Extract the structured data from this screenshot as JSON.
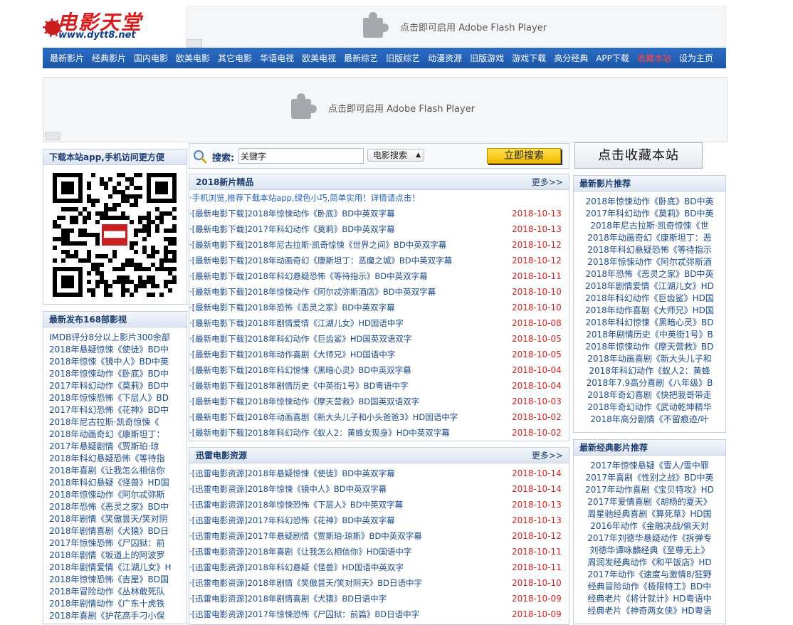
{
  "logo": {
    "title": "电影天堂",
    "domain": "www.dytt8.net"
  },
  "flash": {
    "message": "点击即可启用 Adobe Flash Player"
  },
  "nav": {
    "items": [
      "最新影片",
      "经典影片",
      "国内电影",
      "欧美电影",
      "其它电影",
      "华语电视",
      "欧美电视",
      "最新综艺",
      "旧版综艺",
      "动漫资源",
      "旧版游戏",
      "游戏下载",
      "高分经典",
      "APP下载",
      "收藏本站",
      "设为主页"
    ],
    "highlight_index": 14
  },
  "left_app": {
    "title": "下载本站app,手机访问更方便"
  },
  "left_new": {
    "title": "最新发布168部影视",
    "items": [
      "IMDB评分8分以上影片300余部",
      "2018年悬疑惊悚《使徒》BD中",
      "2018年惊悚《镜中人》BD中英",
      "2018年惊悚动作《卧底》BD中",
      "2017年科幻动作《莫莉》BD中",
      "2018年惊悚恐怖《下层人》BD",
      "2017年科幻恐怖《花神》BD中",
      "2018年尼古拉斯·凯奇惊悚《",
      "2018年动画奇幻《康斯坦丁：",
      "2017年悬疑剧情《贾斯珀·琼",
      "2018年科幻悬疑恐怖《等待指",
      "2018年喜剧《让我怎么相信你",
      "2018年科幻悬疑《怪兽》HD国",
      "2018年惊悚动作《阿尔忒弥斯",
      "2018年恐怖《恶灵之家》BD中",
      "2018年剧情《笑傲昙天/笑对阴",
      "2018年剧情喜剧《犬猿》BD日",
      "2017年惊悚恐怖《尸囚狱：前",
      "2018年剧情《坂道上的阿波罗",
      "2018年剧情爱情《江湖儿女》H",
      "2018年惊悚恐怖《吉屋》BD国",
      "2018年冒险动作《丛林敢死队",
      "2018年剧情动作《广东十虎铁",
      "2018年喜剧《护花高手刁小保"
    ]
  },
  "search": {
    "label": "搜索:",
    "value": "关键字",
    "select_value": "电影搜索",
    "button": "立即搜索"
  },
  "panel_new": {
    "title": "2018新片精品",
    "more": "更多>>",
    "notice": "·手机浏览,推荐下载本站app,绿色小巧,简单实用！详情请点击！",
    "rows": [
      {
        "title": "·[最新电影下载]2018年惊悚动作《卧底》BD中英双字幕",
        "date": "2018-10-13"
      },
      {
        "title": "·[最新电影下载]2017年科幻动作《莫莉》BD中英双字幕",
        "date": "2018-10-13"
      },
      {
        "title": "·[最新电影下载]2018年尼古拉斯·凯奇惊悚《世界之间》BD中英双字幕",
        "date": "2018-10-12"
      },
      {
        "title": "·[最新电影下载]2018年动画奇幻《康斯坦丁：恶魔之城》BD中英双字幕",
        "date": "2018-10-12"
      },
      {
        "title": "·[最新电影下载]2018年科幻悬疑恐怖《等待指示》BD中英双字幕",
        "date": "2018-10-11"
      },
      {
        "title": "·[最新电影下载]2018年惊悚动作《阿尔忒弥斯酒店》BD中英双字幕",
        "date": "2018-10-10"
      },
      {
        "title": "·[最新电影下载]2018年恐怖《恶灵之家》BD中英双字幕",
        "date": "2018-10-10"
      },
      {
        "title": "·[最新电影下载]2018年剧情爱情《江湖儿女》HD国语中字",
        "date": "2018-10-08"
      },
      {
        "title": "·[最新电影下载]2018年科幻动作《巨齿鲨》HD国英双语双字",
        "date": "2018-10-05"
      },
      {
        "title": "·[最新电影下载]2018年动作喜剧《大师兄》HD国语中字",
        "date": "2018-10-05"
      },
      {
        "title": "·[最新电影下载]2018年科幻惊悚《黑暗心灵》BD中英双字幕",
        "date": "2018-10-04"
      },
      {
        "title": "·[最新电影下载]2018年剧情历史《中英街1号》BD粤语中字",
        "date": "2018-10-04"
      },
      {
        "title": "·[最新电影下载]2018年惊悚动作《摩天营救》BD国英双语双字",
        "date": "2018-10-03"
      },
      {
        "title": "·[最新电影下载]2018年动画喜剧《新大头儿子和小头爸爸3》HD国语中字",
        "date": "2018-10-02"
      },
      {
        "title": "·[最新电影下载]2018年科幻动作《蚁人2：黄蜂女现身》HD中英双字幕",
        "date": "2018-10-02"
      }
    ]
  },
  "panel_xunlei": {
    "title": "迅雷电影资源",
    "more": "更多>>",
    "rows": [
      {
        "title": "·[迅雷电影资源]2018年悬疑惊悚《使徒》BD中英双字幕",
        "date": "2018-10-14"
      },
      {
        "title": "·[迅雷电影资源]2018年惊悚《镜中人》BD中英双字幕",
        "date": "2018-10-14"
      },
      {
        "title": "·[迅雷电影资源]2018年惊悚恐怖《下层人》BD中英双字幕",
        "date": "2018-10-13"
      },
      {
        "title": "·[迅雷电影资源]2017年科幻恐怖《花神》BD中英双字幕",
        "date": "2018-10-13"
      },
      {
        "title": "·[迅雷电影资源]2017年悬疑剧情《贾斯珀·琼斯》BD中英双字幕",
        "date": "2018-10-12"
      },
      {
        "title": "·[迅雷电影资源]2018年喜剧《让我怎么相信你》HD国语中字",
        "date": "2018-10-11"
      },
      {
        "title": "·[迅雷电影资源]2018年科幻悬疑《怪兽》HD国语中英双字",
        "date": "2018-10-11"
      },
      {
        "title": "·[迅雷电影资源]2018年剧情《笑傲昙天/笑对阴天》BD日语中字",
        "date": "2018-10-10"
      },
      {
        "title": "·[迅雷电影资源]2018年剧情喜剧《犬猿》BD日语中字",
        "date": "2018-10-09"
      },
      {
        "title": "·[迅雷电影资源]2017年惊悚恐怖《尸囚狱：前篇》BD日语中字",
        "date": "2018-10-09"
      }
    ]
  },
  "fav": {
    "label": "点击收藏本站"
  },
  "right_recommend": {
    "title": "最新影片推荐",
    "items": [
      "2018年惊悚动作《卧底》BD中英",
      "2017年科幻动作《莫莉》BD中英",
      "2018年尼古拉斯·凯奇惊悚《世",
      "2018年动画奇幻《康斯坦丁：恶",
      "2018年科幻悬疑恐怖《等待指示",
      "2018年惊悚动作《阿尔忒弥斯酒",
      "2018年恐怖《恶灵之家》BD中英",
      "2018年剧情爱情《江湖儿女》HD",
      "2018年科幻动作《巨齿鲨》HD国",
      "2018年动作喜剧《大师兄》HD国",
      "2018年科幻惊悚《黑暗心灵》BD",
      "2018年剧情历史《中英街1号》B",
      "2018年惊悚动作《摩天营救》BD",
      "2018年动画喜剧《新大头儿子和",
      "2018年科幻动作《蚁人2：黄蜂",
      "2018年7.9高分喜剧《八年级》B",
      "2018年奇幻喜剧《快把我哥带走",
      "2018年奇幻动作《武动乾坤精华",
      "2018年高分剧情《不留痕迹/叶"
    ]
  },
  "right_classic": {
    "title": "最新经典影片推荐",
    "items": [
      "2017年惊悚悬疑《雪人/雪中罪",
      "2017年喜剧《性别之战》BD中英",
      "2017年动作喜剧《宝贝特攻》HD",
      "2017年爱情喜剧《胡杨的夏天》",
      "周星驰经典喜剧《算死草》HD国",
      "2016年动作《金融决战/偷天对",
      "2017年刘德华悬疑动作《拆弹专",
      "刘德华谭咏麟经典《至尊无上》",
      "周润发经典动作《和平饭店》HD",
      "2017年动作《速度与激情8/狂野",
      "经典冒险动作《极限特工》BD中",
      "经典老片《将计就计》HD粤语中",
      "经典老片《神奇两女侠》HD粤语"
    ]
  }
}
